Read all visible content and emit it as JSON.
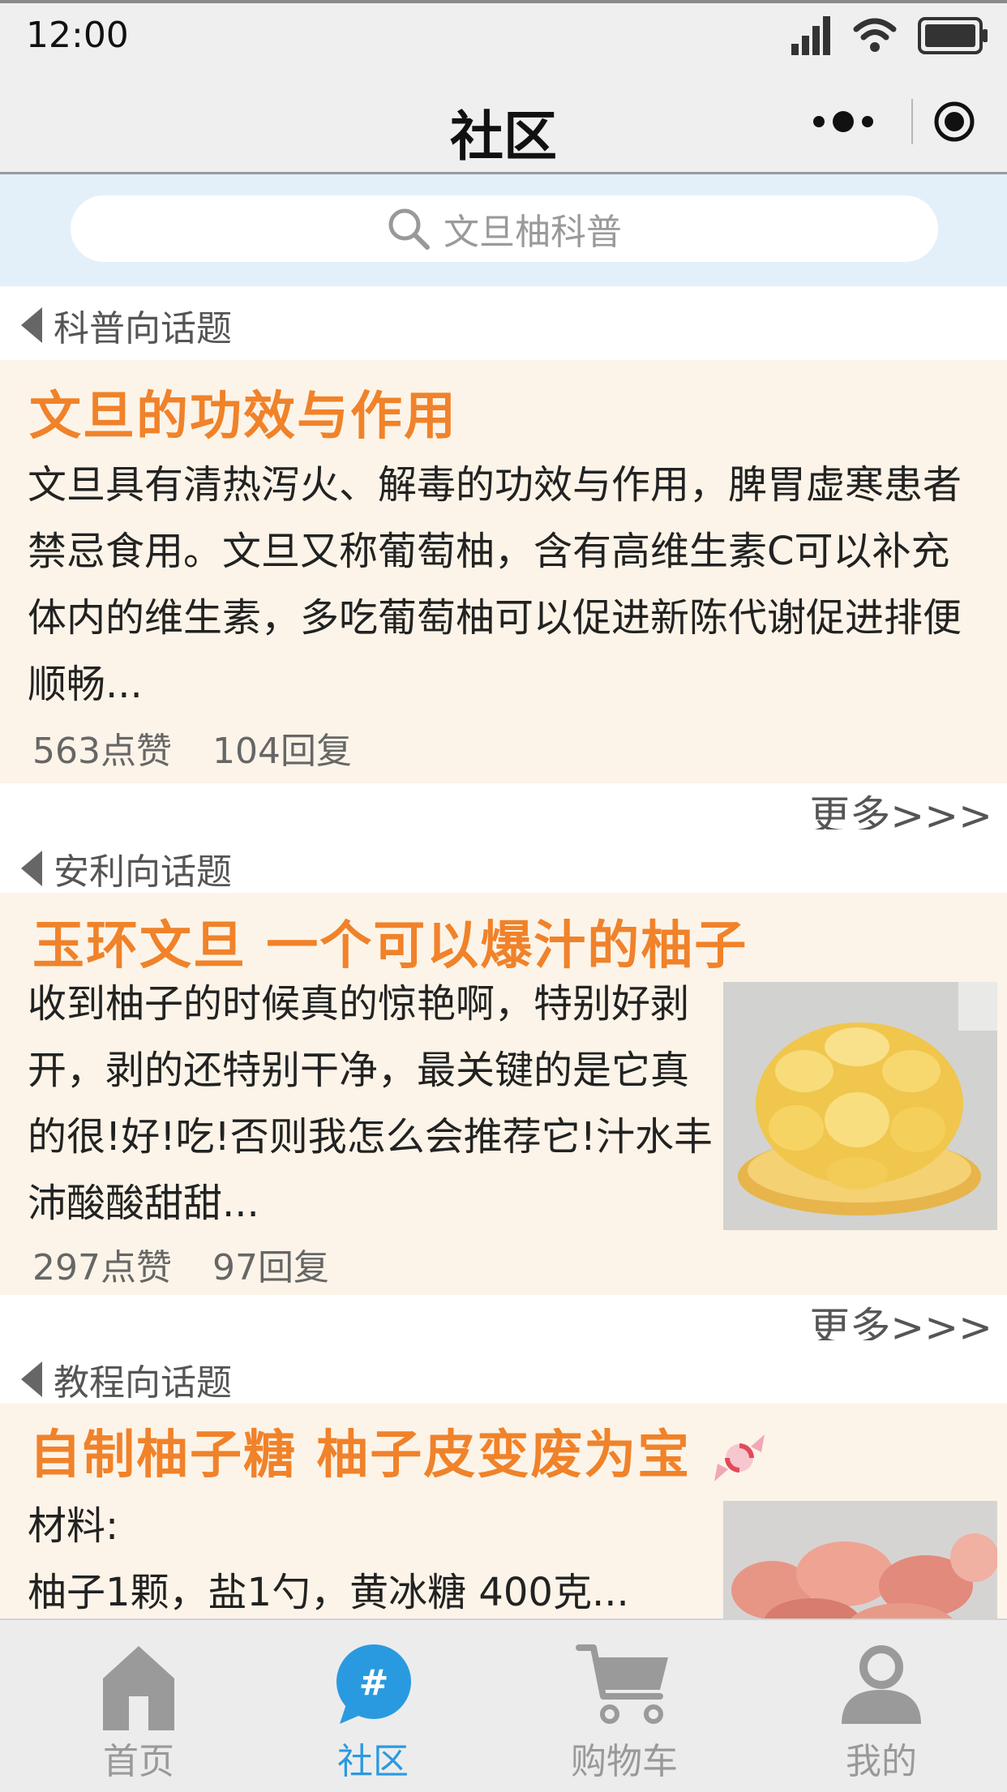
{
  "status_bar": {
    "time": "12:00"
  },
  "nav": {
    "title": "社区"
  },
  "search": {
    "placeholder": "文旦柚科普"
  },
  "sections": [
    {
      "label": "科普向话题",
      "title": "文旦的功效与作用",
      "body": "文旦具有清热泻火、解毒的功效与作用，脾胃虚寒患者禁忌食用。文旦又称葡萄柚，含有高维生素C可以补充体内的维生素，多吃葡萄柚可以促进新陈代谢促进排便顺畅...",
      "likes": "563点赞",
      "replies": "104回复",
      "more": "更多>>>"
    },
    {
      "label": "安利向话题",
      "title": "玉环文旦 一个可以爆汁的柚子",
      "body": "收到柚子的时候真的惊艳啊，特别好剥开，剥的还特别干净，最关键的是它真的很!好!吃!否则我怎么会推荐它!汁水丰沛酸酸甜甜...",
      "likes": "297点赞",
      "replies": "97回复",
      "more": "更多>>>"
    },
    {
      "label": "教程向话题",
      "title": "自制柚子糖 柚子皮变废为宝",
      "body_line1": "材料:",
      "body_line2": "柚子1颗，盐1勺，黄冰糖 400克..."
    }
  ],
  "tabs": [
    {
      "label": "首页",
      "icon": "home-icon"
    },
    {
      "label": "社区",
      "icon": "community-icon"
    },
    {
      "label": "购物车",
      "icon": "cart-icon"
    },
    {
      "label": "我的",
      "icon": "profile-icon"
    }
  ],
  "colors": {
    "accent": "#f0822a",
    "active_tab": "#2a9ae0",
    "card_bg": "#fcf4e8",
    "search_band": "#e3f0fa"
  }
}
